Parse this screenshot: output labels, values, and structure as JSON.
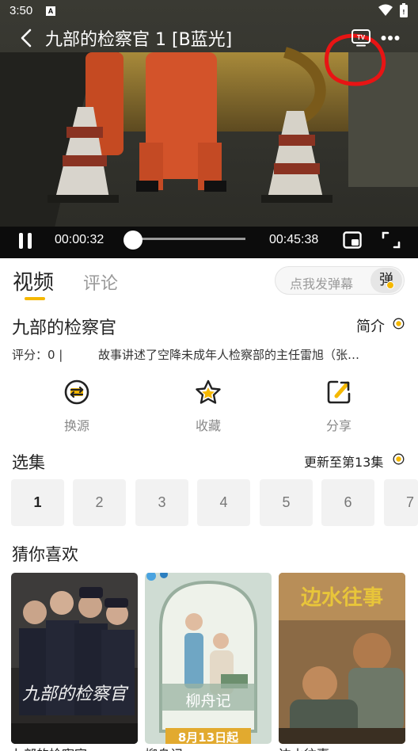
{
  "status_bar": {
    "time": "3:50",
    "notification_icon": "A"
  },
  "player": {
    "title": "九部的检察官 1 [B蓝光]",
    "current_time": "00:00:32",
    "total_time": "00:45:38",
    "progress": 0.012,
    "tv_label": "TV",
    "icons": [
      "back-arrow-icon",
      "tv-cast-icon",
      "more-icon",
      "pause-icon",
      "pip-icon",
      "fullscreen-icon"
    ]
  },
  "tabs": {
    "video": "视频",
    "comment": "评论"
  },
  "danmu": {
    "placeholder": "点我发弹幕",
    "button": "弹"
  },
  "info": {
    "title": "九部的检察官",
    "intro_label": "简介",
    "rating": "评分：0 |",
    "description": "故事讲述了空降未成年人检察部的主任雷旭（张…"
  },
  "actions": [
    {
      "label": "换源",
      "icon": "switch-source-icon"
    },
    {
      "label": "收藏",
      "icon": "star-icon"
    },
    {
      "label": "分享",
      "icon": "share-icon"
    }
  ],
  "episodes": {
    "heading": "选集",
    "update": "更新至第13集",
    "items": [
      "1",
      "2",
      "3",
      "4",
      "5",
      "6",
      "7"
    ]
  },
  "recommendations": {
    "heading": "猜你喜欢",
    "items": [
      {
        "title": "九部的检察官",
        "poster_text": "九部的检察官"
      },
      {
        "title": "柳舟记",
        "poster_text": "柳舟记",
        "poster_date": "8月13日起"
      },
      {
        "title": "边水往事",
        "poster_text": "边水往事"
      }
    ]
  },
  "colors": {
    "accent": "#f5b800",
    "annotation_red": "#e81414",
    "tab_inactive": "#999999"
  }
}
